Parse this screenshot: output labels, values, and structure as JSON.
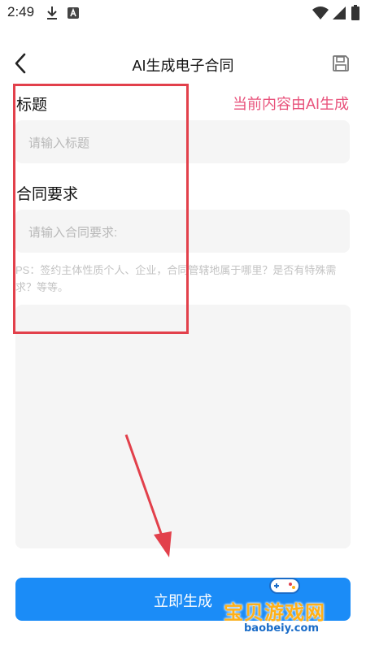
{
  "status_bar": {
    "time": "2:49",
    "icons": [
      "download-icon",
      "a-box-icon",
      "wifi-icon",
      "signal-icon",
      "battery-icon"
    ]
  },
  "header": {
    "title": "AI生成电子合同",
    "back_icon": "chevron-left-icon",
    "save_icon": "save-icon"
  },
  "form": {
    "title_label": "标题",
    "ai_note": "当前内容由AI生成",
    "title_placeholder": "请输入标题",
    "requirements_label": "合同要求",
    "requirements_placeholder": "请输入合同要求:",
    "hint": "PS：签约主体性质个人、企业，合同管辖地属于哪里？是否有特殊需求？等等。"
  },
  "actions": {
    "generate_label": "立即生成"
  },
  "watermark": {
    "text": "宝贝游戏网",
    "domain": "baobeiy.com"
  },
  "colors": {
    "accent": "#1b8cf7",
    "ai_note": "#e8527b",
    "annotation": "#e2404b",
    "watermark": "#ffb018"
  }
}
